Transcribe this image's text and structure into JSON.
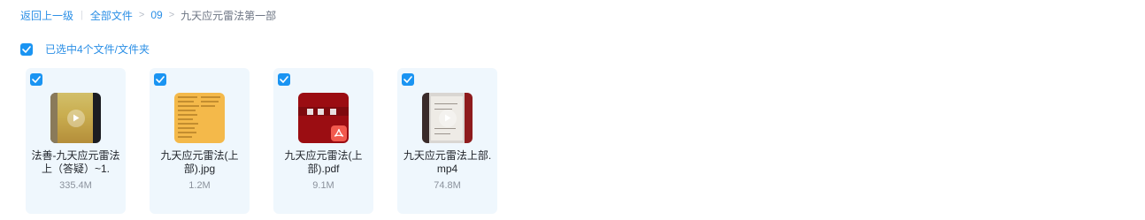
{
  "breadcrumb": {
    "back": "返回上一级",
    "all_files": "全部文件",
    "folder": "09",
    "current": "九天应元雷法第一部",
    "bar_separator": "|",
    "chevron_separator": ">"
  },
  "selection": {
    "label": "已选中4个文件/文件夹",
    "checked": true
  },
  "files": [
    {
      "name": "法善-九天应元雷法上（答疑）~1.",
      "size": "335.4M",
      "type": "video",
      "checked": true
    },
    {
      "name": "九天应元雷法(上部).jpg",
      "size": "1.2M",
      "type": "image",
      "checked": true
    },
    {
      "name": "九天应元雷法(上部).pdf",
      "size": "9.1M",
      "type": "pdf",
      "checked": true
    },
    {
      "name": "九天应元雷法上部.mp4",
      "size": "74.8M",
      "type": "video",
      "checked": true
    }
  ],
  "colors": {
    "accent": "#1a94f2",
    "link": "#2b8fe6",
    "card_bg": "#eff7fd",
    "pdf_badge": "#f25a4e"
  },
  "icons": {
    "checkbox": "check-icon",
    "video_overlay": "play-icon",
    "pdf_badge": "pdf-icon"
  }
}
